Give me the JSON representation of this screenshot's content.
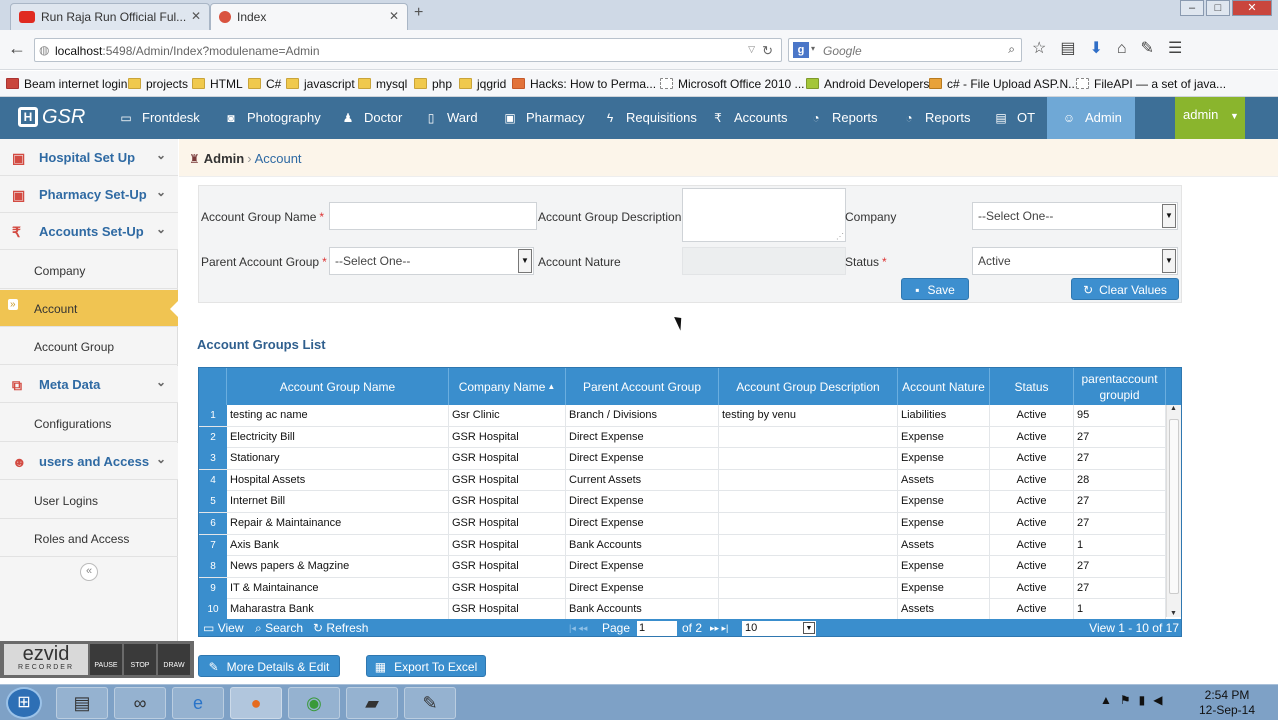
{
  "browser": {
    "tabs": [
      {
        "title": "Run Raja Run Official Ful...",
        "fav_color": "#e02a20"
      },
      {
        "title": "Index",
        "fav_color": "#d9533f"
      }
    ],
    "new_tab": "+",
    "url_host": "localhost",
    "url_rest": ":5498/Admin/Index?modulename=Admin",
    "search_engine": "g",
    "search_placeholder": "Google",
    "bookmarks": [
      {
        "label": "Beam internet login"
      },
      {
        "label": "projects"
      },
      {
        "label": "HTML"
      },
      {
        "label": "C#"
      },
      {
        "label": "javascript"
      },
      {
        "label": "mysql"
      },
      {
        "label": "php"
      },
      {
        "label": "jqgrid"
      },
      {
        "label": "Hacks: How to Perma..."
      },
      {
        "label": "Microsoft Office 2010 ..."
      },
      {
        "label": "Android Developers"
      },
      {
        "label": "c# - File Upload ASP.N..."
      },
      {
        "label": "FileAPI — a set of java..."
      }
    ]
  },
  "app": {
    "logo": "GSR",
    "menu": [
      {
        "label": "Frontdesk",
        "icon": "monitor-icon"
      },
      {
        "label": "Photography",
        "icon": "camera-icon"
      },
      {
        "label": "Doctor",
        "icon": "user-md-icon"
      },
      {
        "label": "Ward",
        "icon": "book-icon"
      },
      {
        "label": "Pharmacy",
        "icon": "briefcase-icon"
      },
      {
        "label": "Requisitions",
        "icon": "bolt-icon"
      },
      {
        "label": "Accounts",
        "icon": "rupee-icon"
      },
      {
        "label": "Reports",
        "icon": "dashboard-icon"
      },
      {
        "label": "Reports",
        "icon": "dashboard-icon"
      },
      {
        "label": "OT",
        "icon": "clipboard-icon"
      },
      {
        "label": "Admin",
        "icon": "users-icon"
      }
    ],
    "user": "admin",
    "accent": "#3d6f97",
    "active_menu_color": "#6fa8d6",
    "user_color": "#8ab52d"
  },
  "sidebar": {
    "items": [
      {
        "label": "Hospital Set Up",
        "type": "head"
      },
      {
        "label": "Pharmacy Set-Up",
        "type": "head"
      },
      {
        "label": "Accounts Set-Up",
        "type": "head"
      },
      {
        "label": "Company",
        "type": "sub"
      },
      {
        "label": "Account",
        "type": "sub",
        "active": true
      },
      {
        "label": "Account Group",
        "type": "sub"
      },
      {
        "label": "Meta Data",
        "type": "head"
      },
      {
        "label": "Configurations",
        "type": "sub"
      },
      {
        "label": "users and Access",
        "type": "head"
      },
      {
        "label": "User Logins",
        "type": "sub"
      },
      {
        "label": "Roles and Access",
        "type": "sub"
      }
    ],
    "collapse": "«"
  },
  "breadcrumb": {
    "root": "Admin",
    "current": "Account",
    "sep": "›"
  },
  "form": {
    "account_group_name_label": "Account Group Name",
    "account_group_name_value": "",
    "account_group_description_label": "Account Group Description",
    "company_label": "Company",
    "company_value": "--Select One--",
    "parent_account_group_label": "Parent Account Group",
    "parent_account_group_value": "--Select One--",
    "account_nature_label": "Account Nature",
    "status_label": "Status",
    "status_value": "Active",
    "required_mark": "*",
    "save_label": "Save",
    "clear_label": "Clear Values"
  },
  "list": {
    "title": "Account Groups List",
    "columns": [
      "Account Group Name",
      "Company Name",
      "Parent Account Group",
      "Account Group Description",
      "Account Nature",
      "Status",
      "parentaccount groupid"
    ],
    "rows": [
      [
        "1",
        "testing ac name",
        "Gsr Clinic",
        "Branch / Divisions",
        "testing by venu",
        "Liabilities",
        "Active",
        "95"
      ],
      [
        "2",
        "Electricity Bill",
        "GSR Hospital",
        "Direct Expense",
        "",
        "Expense",
        "Active",
        "27"
      ],
      [
        "3",
        "Stationary",
        "GSR Hospital",
        "Direct Expense",
        "",
        "Expense",
        "Active",
        "27"
      ],
      [
        "4",
        "Hospital Assets",
        "GSR Hospital",
        "Current Assets",
        "",
        "Assets",
        "Active",
        "28"
      ],
      [
        "5",
        "Internet Bill",
        "GSR Hospital",
        "Direct Expense",
        "",
        "Expense",
        "Active",
        "27"
      ],
      [
        "6",
        "Repair & Maintainance",
        "GSR Hospital",
        "Direct Expense",
        "",
        "Expense",
        "Active",
        "27"
      ],
      [
        "7",
        "Axis Bank",
        "GSR Hospital",
        "Bank Accounts",
        "",
        "Assets",
        "Active",
        "1"
      ],
      [
        "8",
        "News papers & Magzine",
        "GSR Hospital",
        "Direct Expense",
        "",
        "Expense",
        "Active",
        "27"
      ],
      [
        "9",
        "IT & Maintainance",
        "GSR Hospital",
        "Direct Expense",
        "",
        "Expense",
        "Active",
        "27"
      ],
      [
        "10",
        "Maharastra Bank",
        "GSR Hospital",
        "Bank Accounts",
        "",
        "Assets",
        "Active",
        "1"
      ]
    ],
    "pager": {
      "view": "View",
      "search": "Search",
      "refresh": "Refresh",
      "page_label": "Page",
      "page_value": "1",
      "of_label": "of 2",
      "rows_value": "10",
      "summary": "View 1 - 10 of 17"
    },
    "more_details_label": "More Details & Edit",
    "export_label": "Export To Excel"
  },
  "ezvid": {
    "logo": "ezvid",
    "sub": "RECORDER",
    "buttons": [
      "PAUSE",
      "STOP",
      "DRAW"
    ]
  },
  "taskbar": {
    "time": "2:54 PM",
    "date": "12-Sep-14"
  }
}
